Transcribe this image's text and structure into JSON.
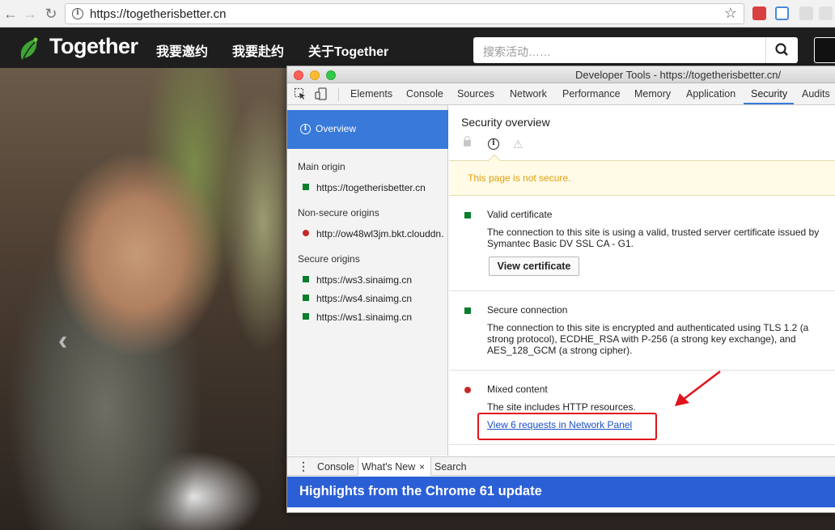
{
  "browser": {
    "url": "https://togetherisbetter.cn",
    "back_icon": "back-arrow-icon",
    "forward_icon": "forward-arrow-icon",
    "reload_icon": "reload-icon"
  },
  "site": {
    "logo_text": "Together",
    "nav": [
      "我要邀约",
      "我要赴约",
      "关于Together"
    ],
    "search_placeholder": "搜索活动……"
  },
  "devtools": {
    "window_title": "Developer Tools - https://togetherisbetter.cn/",
    "tabs": [
      "Elements",
      "Console",
      "Sources",
      "Network",
      "Performance",
      "Memory",
      "Application",
      "Security",
      "Audits"
    ],
    "active_tab": "Security",
    "sidebar": {
      "overview_label": "Overview",
      "main_origin_heading": "Main origin",
      "main_origin": "https://togetherisbetter.cn",
      "non_secure_heading": "Non-secure origins",
      "non_secure_origin": "http://ow48wl3jm.bkt.clouddn.",
      "secure_heading": "Secure origins",
      "secure_origins": [
        "https://ws3.sinaimg.cn",
        "https://ws4.sinaimg.cn",
        "https://ws1.sinaimg.cn"
      ]
    },
    "security": {
      "title": "Security overview",
      "banner": "This page is not secure.",
      "cert_title": "Valid certificate",
      "cert_desc": "The connection to this site is using a valid, trusted server certificate issued by Symantec Basic DV SSL CA - G1.",
      "cert_button": "View certificate",
      "conn_title": "Secure connection",
      "conn_desc": "The connection to this site is encrypted and authenticated using TLS 1.2 (a strong protocol), ECDHE_RSA with P-256 (a strong key exchange), and AES_128_GCM (a strong cipher).",
      "mixed_title": "Mixed content",
      "mixed_desc": "The site includes HTTP resources.",
      "mixed_link": "View 6 requests in Network Panel"
    },
    "drawer": {
      "tabs": [
        "Console",
        "What's New",
        "Search"
      ],
      "active_tab": "What's New",
      "close_glyph": "×",
      "highlights": "Highlights from the Chrome 61 update"
    }
  },
  "colors": {
    "accent_blue": "#3879d9",
    "secure_green": "#0a7e2a",
    "insecure_red": "#c62828",
    "warning_text": "#e0a010",
    "annotation_red": "#e0141c"
  }
}
